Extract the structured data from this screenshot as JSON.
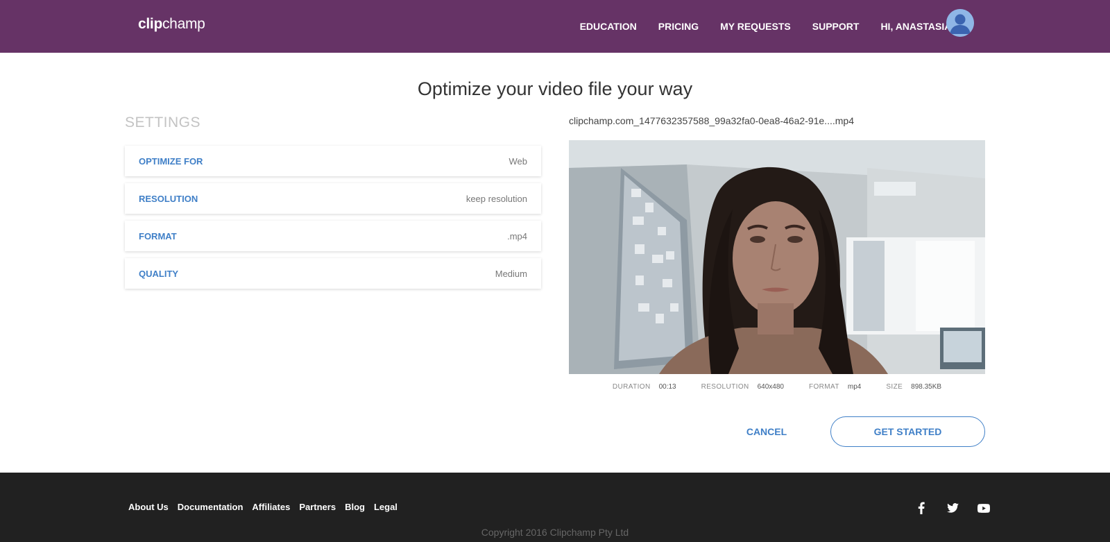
{
  "header": {
    "logo_bold": "clip",
    "logo_light": "champ",
    "nav": [
      "EDUCATION",
      "PRICING",
      "MY REQUESTS",
      "SUPPORT",
      "HI, ANASTASIA!"
    ]
  },
  "main": {
    "title": "Optimize your video file your way",
    "settings_heading": "SETTINGS",
    "settings": [
      {
        "label": "OPTIMIZE FOR",
        "value": "Web"
      },
      {
        "label": "RESOLUTION",
        "value": "keep resolution"
      },
      {
        "label": "FORMAT",
        "value": ".mp4"
      },
      {
        "label": "QUALITY",
        "value": "Medium"
      }
    ],
    "file_name": "clipchamp.com_1477632357588_99a32fa0-0ea8-46a2-91e....mp4",
    "meta": [
      {
        "key": "DURATION",
        "value": "00:13"
      },
      {
        "key": "RESOLUTION",
        "value": "640x480"
      },
      {
        "key": "FORMAT",
        "value": "mp4"
      },
      {
        "key": "SIZE",
        "value": "898.35KB"
      }
    ],
    "cancel_label": "CANCEL",
    "start_label": "GET STARTED"
  },
  "footer": {
    "links": [
      "About Us",
      "Documentation",
      "Affiliates",
      "Partners",
      "Blog",
      "Legal"
    ],
    "social_icons": [
      "facebook-icon",
      "twitter-icon",
      "youtube-icon"
    ],
    "copyright": "Copyright 2016 Clipchamp Pty Ltd"
  },
  "colors": {
    "header_bg": "#663366",
    "accent_blue": "#3f7fc7",
    "footer_bg": "#212121"
  }
}
